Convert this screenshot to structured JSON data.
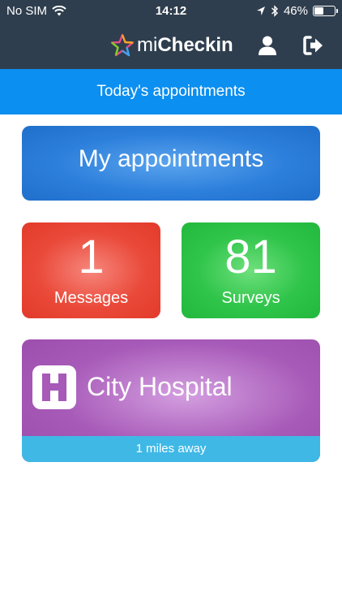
{
  "status_bar": {
    "carrier": "No SIM",
    "time": "14:12",
    "battery": "46%",
    "battery_level": 0.46
  },
  "header": {
    "brand_prefix": "mi",
    "brand_bold": "Checkin",
    "profile_icon": "user-icon",
    "logout_icon": "logout-icon"
  },
  "subheader": {
    "title": "Today's appointments"
  },
  "tiles": {
    "appointments": {
      "label": "My appointments",
      "color": "#2c7fdb"
    },
    "messages": {
      "count": "1",
      "label": "Messages",
      "color": "#ea4a3a"
    },
    "surveys": {
      "count": "81",
      "label": "Surveys",
      "color": "#2fc44a"
    }
  },
  "hospital": {
    "name": "City Hospital",
    "distance": "1 miles away",
    "logo_icon": "hospital-h-icon",
    "color": "#a75ab8",
    "distance_bar_color": "#3fb8e6"
  }
}
